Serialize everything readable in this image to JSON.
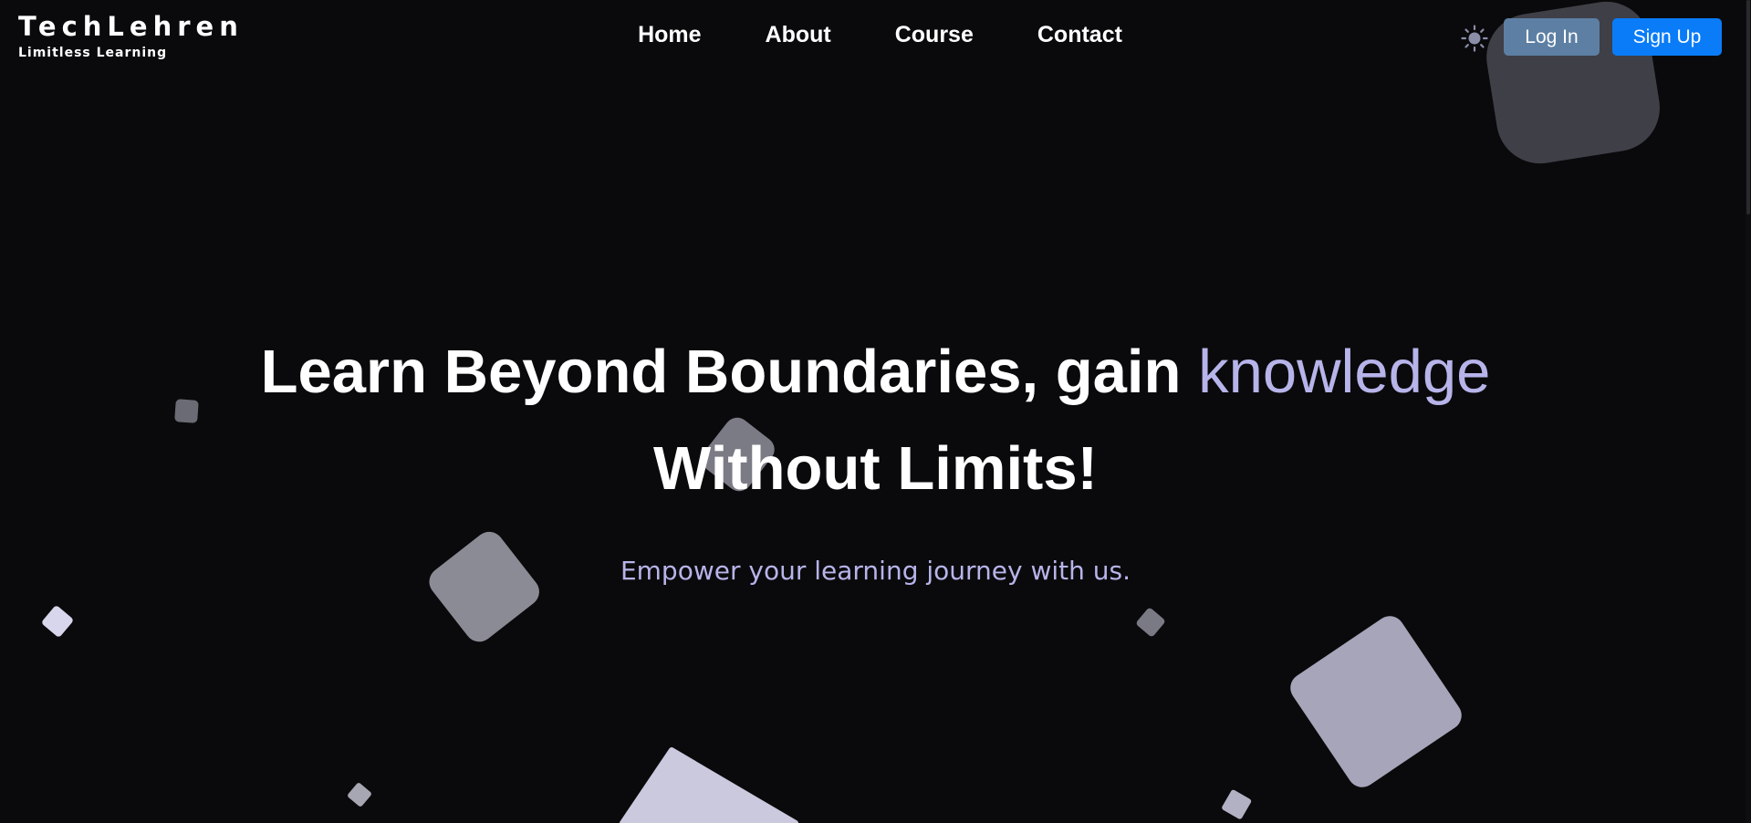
{
  "brand": {
    "name": "TechLehren",
    "tagline": "Limitless Learning"
  },
  "nav": {
    "items": [
      {
        "label": "Home"
      },
      {
        "label": "About"
      },
      {
        "label": "Course"
      },
      {
        "label": "Contact"
      }
    ]
  },
  "header_actions": {
    "theme_icon": "sun-icon",
    "login_label": "Log In",
    "signup_label": "Sign Up"
  },
  "hero": {
    "title_part1": "Learn Beyond Boundaries, gain",
    "title_highlight": "knowledge",
    "title_part2": "Without Limits!",
    "subtitle": "Empower your learning journey with us."
  },
  "colors": {
    "background": "#0a0a0c",
    "highlight": "#b7b4ea",
    "login_button": "#5d7fa3",
    "signup_button": "#0a7cf7"
  }
}
